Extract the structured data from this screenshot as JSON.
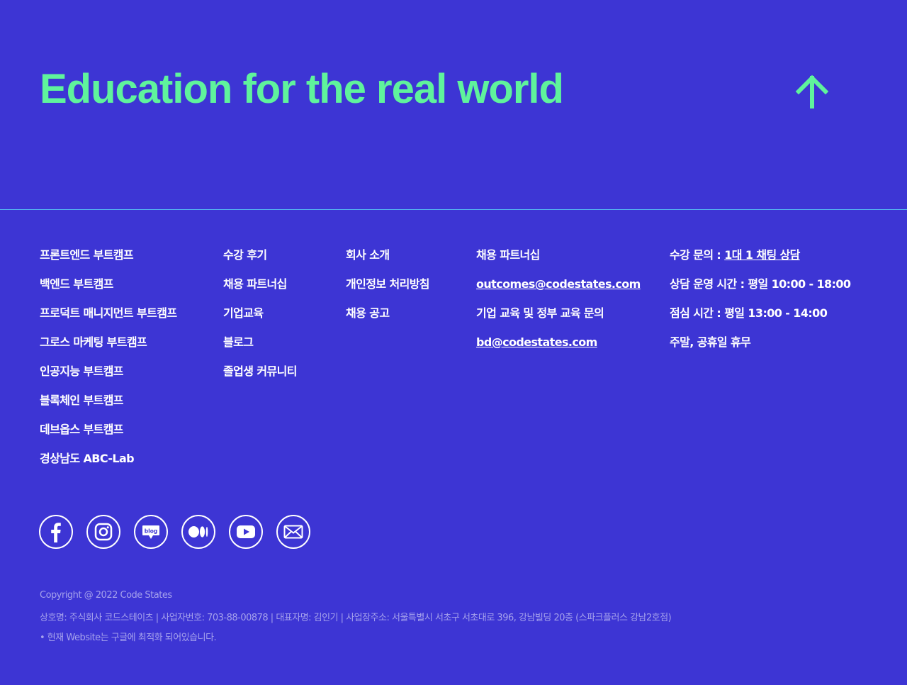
{
  "hero": {
    "title": "Education for the real world"
  },
  "colors": {
    "background": "#3d35d4",
    "accent": "#5ff39c",
    "divider": "#53b3f0",
    "muted": "#a5a1ec"
  },
  "footer": {
    "bootcamps": [
      "프론트엔드 부트캠프",
      "백엔드 부트캠프",
      "프로덕트 매니지먼트 부트캠프",
      "그로스 마케팅 부트캠프",
      "인공지능 부트캠프",
      "블록체인 부트캠프",
      "데브옵스 부트캠프",
      "경상남도 ABC-Lab"
    ],
    "resources": [
      "수강 후기",
      "채용 파트너십",
      "기업교육",
      "블로그",
      "졸업생 커뮤니티"
    ],
    "company": [
      "회사 소개",
      "개인정보 처리방침",
      "채용 공고"
    ],
    "partnership": {
      "title": "채용 파트너십",
      "email": "outcomes@codestates.com",
      "edu_title": "기업 교육 및 정부 교육 문의",
      "edu_email": "bd@codestates.com"
    },
    "contact": {
      "inquiry_label": "수강 문의 : ",
      "inquiry_link": "1대 1 채팅 상담",
      "hours": "상담 운영 시간 : 평일 10:00 - 18:00",
      "lunch": "점심 시간 : 평일 13:00 - 14:00",
      "closed": "주말, 공휴일 휴무"
    }
  },
  "social_icons": [
    "facebook-icon",
    "instagram-icon",
    "blog-icon",
    "medium-icon",
    "youtube-icon",
    "mail-icon"
  ],
  "social_blog_text": "blog",
  "legal": {
    "copyright": "Copyright @ 2022 Code States",
    "company_info": "상호명: 주식회사 코드스테이츠  |  사업자번호: 703-88-00878  |  대표자명: 김인기 |  사업장주소: 서울특별시 서초구 서초대로 396, 강남빌딩 20층 (스파크플러스 강남2호점)",
    "browser_note": "•  현재 Website는 구글에 최적화 되어있습니다."
  }
}
